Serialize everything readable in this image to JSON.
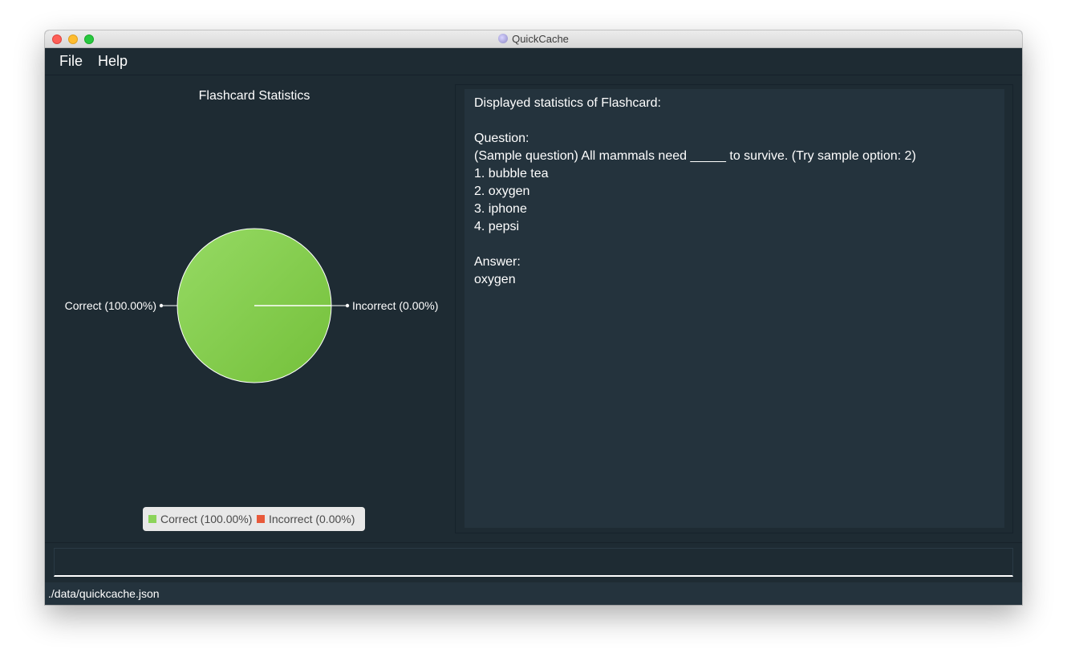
{
  "window": {
    "title": "QuickCache"
  },
  "menu": {
    "file_label": "File",
    "help_label": "Help"
  },
  "chart_data": {
    "type": "pie",
    "title": "Flashcard Statistics",
    "slices": [
      {
        "label": "Correct (100.00%)",
        "value": 100.0,
        "color": "#8cd45a"
      },
      {
        "label": "Incorrect (0.00%)",
        "value": 0.0,
        "color": "#e8593a"
      }
    ],
    "legend": [
      "Correct (100.00%)",
      "Incorrect (0.00%)"
    ],
    "legend_position": "bottom"
  },
  "statistics": {
    "header": "Displayed statistics of Flashcard:",
    "question_label": "Question:",
    "question_text": "(Sample question) All mammals need _____ to survive. (Try sample option: 2)",
    "options": [
      "1. bubble tea",
      "2. oxygen",
      "3. iphone",
      "4. pepsi"
    ],
    "answer_label": "Answer:",
    "answer_text": "oxygen"
  },
  "command_box": {
    "value": ""
  },
  "status_bar": {
    "file_path": "./data/quickcache.json"
  },
  "colors": {
    "background": "#1e2b33",
    "panel": "#24333d",
    "correct": "#8cd45a",
    "incorrect": "#e8593a"
  }
}
